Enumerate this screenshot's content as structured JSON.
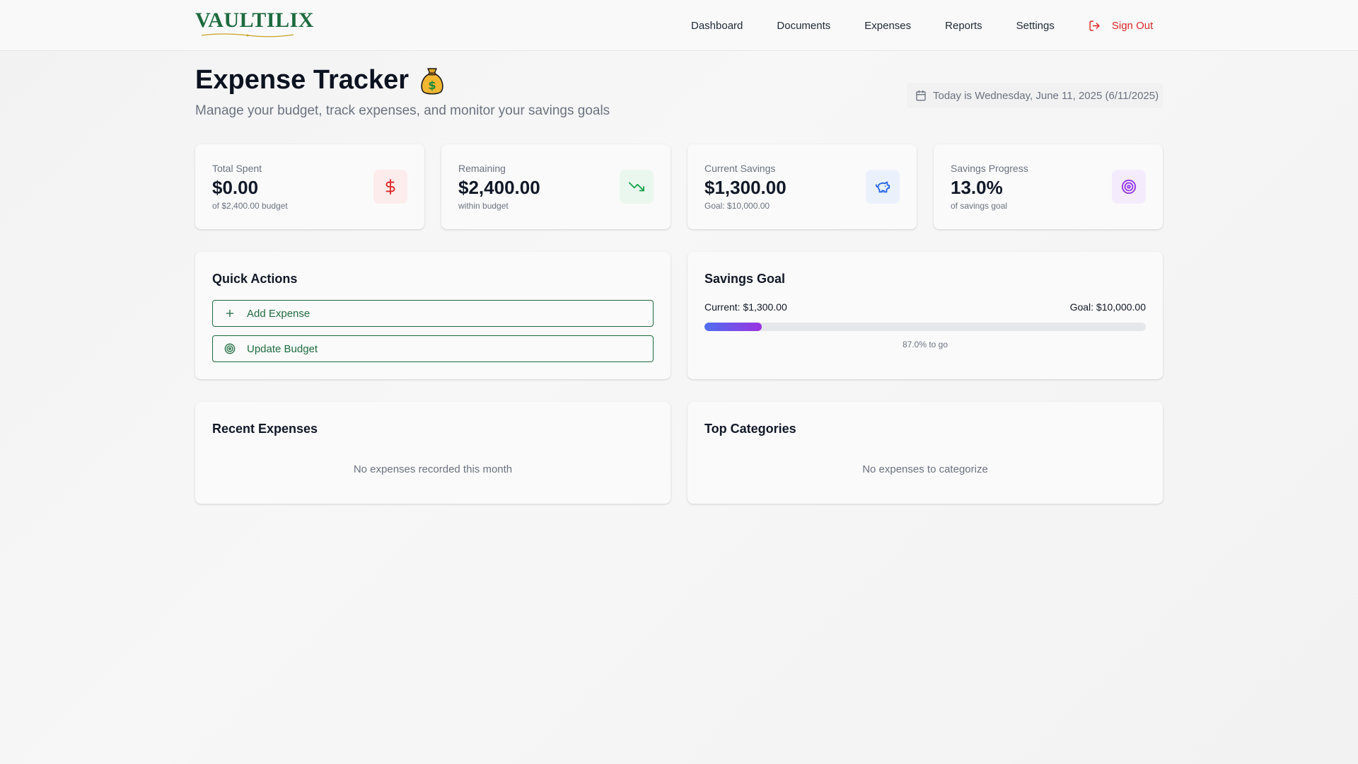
{
  "app": {
    "logo_text": "VAULTILIX"
  },
  "nav": {
    "items": [
      "Dashboard",
      "Documents",
      "Expenses",
      "Reports",
      "Settings"
    ],
    "sign_out": "Sign Out"
  },
  "page": {
    "title": "Expense Tracker",
    "title_emoji": "💰",
    "subtitle": "Manage your budget, track expenses, and monitor your savings goals",
    "date_text": "Today is Wednesday, June 11, 2025 (6/11/2025)"
  },
  "stats": [
    {
      "label": "Total Spent",
      "value": "$0.00",
      "sub": "of $2,400.00 budget",
      "icon": "dollar-icon",
      "icon_color": "#dc2626",
      "icon_bg": "#fdecec"
    },
    {
      "label": "Remaining",
      "value": "$2,400.00",
      "sub": "within budget",
      "icon": "trending-down-icon",
      "icon_color": "#16a34a",
      "icon_bg": "#eaf7ee"
    },
    {
      "label": "Current Savings",
      "value": "$1,300.00",
      "sub": "Goal: $10,000.00",
      "icon": "piggy-bank-icon",
      "icon_color": "#2563eb",
      "icon_bg": "#eaf1fd"
    },
    {
      "label": "Savings Progress",
      "value": "13.0%",
      "sub": "of savings goal",
      "icon": "target-icon",
      "icon_color": "#9333ea",
      "icon_bg": "#f4ecfd"
    }
  ],
  "quick_actions": {
    "title": "Quick Actions",
    "add_expense": "Add Expense",
    "update_budget": "Update Budget"
  },
  "savings_goal": {
    "title": "Savings Goal",
    "current": "Current: $1,300.00",
    "goal": "Goal: $10,000.00",
    "progress_fraction": 0.13,
    "caption": "87.0% to go"
  },
  "recent_expenses": {
    "title": "Recent Expenses",
    "empty": "No expenses recorded this month"
  },
  "top_categories": {
    "title": "Top Categories",
    "empty": "No expenses to categorize"
  },
  "colors": {
    "brand": "#1e6b3f",
    "danger": "#dc2626"
  }
}
